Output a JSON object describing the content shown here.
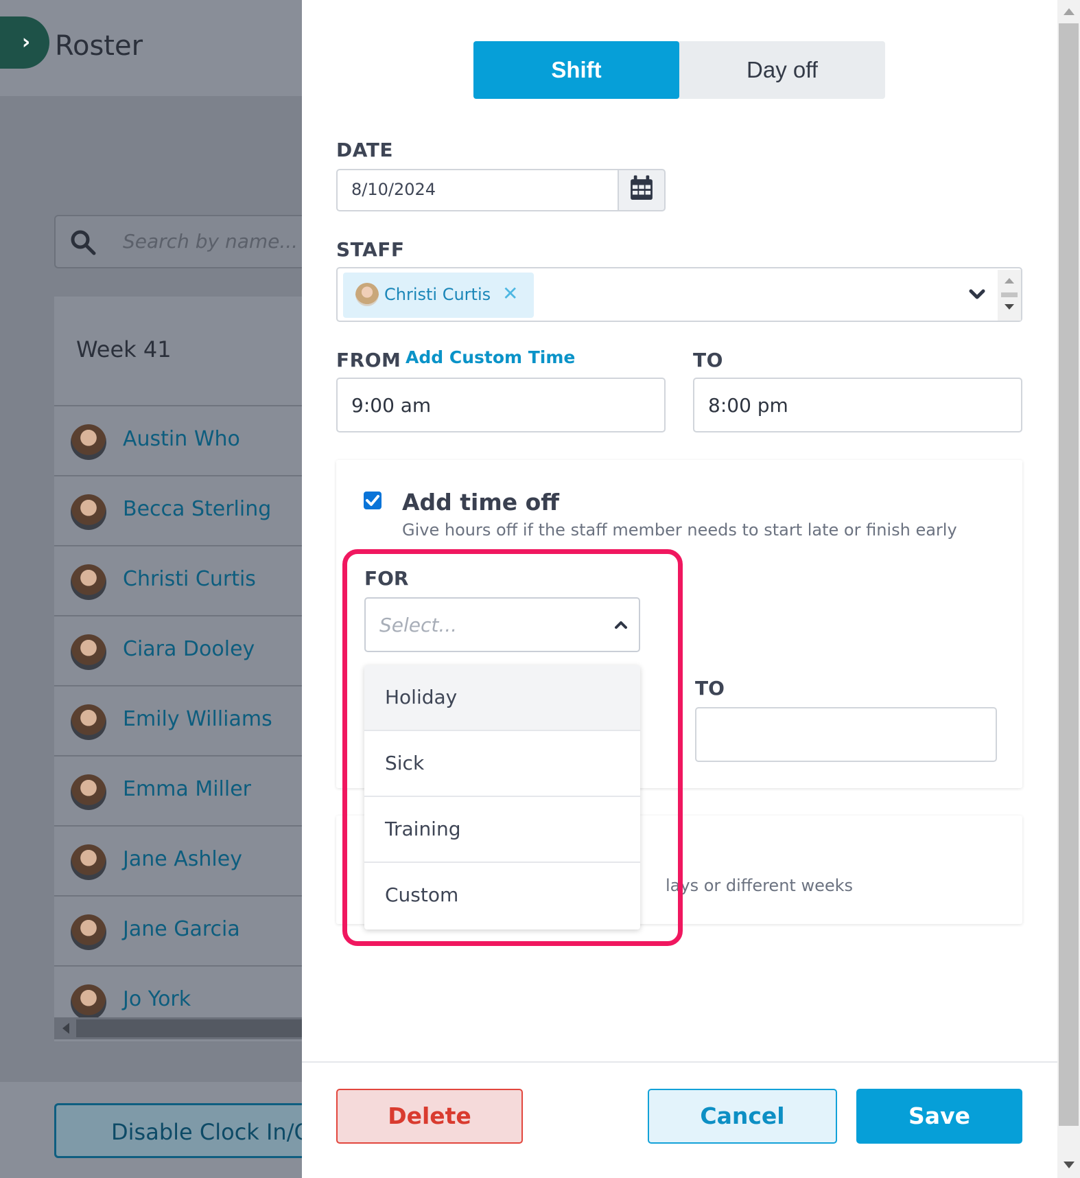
{
  "background": {
    "title": "Roster",
    "search_placeholder": "Search by name...",
    "week_label": "Week 41",
    "staff": [
      "Austin Who",
      "Becca Sterling",
      "Christi Curtis",
      "Ciara Dooley",
      "Emily Williams",
      "Emma Miller",
      "Jane Ashley",
      "Jane Garcia",
      "Jo York"
    ],
    "disable_button": "Disable Clock In/Out"
  },
  "modal": {
    "tabs": {
      "shift": "Shift",
      "day_off": "Day off",
      "active": "Shift"
    },
    "date": {
      "label": "DATE",
      "value": "8/10/2024"
    },
    "staff": {
      "label": "STAFF",
      "selected": "Christi Curtis"
    },
    "from": {
      "label": "FROM",
      "link": "Add Custom Time",
      "value": "9:00 am"
    },
    "to": {
      "label": "TO",
      "value": "8:00 pm"
    },
    "time_off": {
      "checked": true,
      "title": "Add time off",
      "subtitle": "Give hours off if the staff member needs to start late or finish early",
      "for_label": "FOR",
      "for_placeholder": "Select...",
      "options": [
        "Holiday",
        "Sick",
        "Training",
        "Custom"
      ],
      "to_label": "TO"
    },
    "repeat_partial_text": "lays or different weeks",
    "buttons": {
      "delete": "Delete",
      "cancel": "Cancel",
      "save": "Save"
    }
  },
  "colors": {
    "primary": "#069fd8",
    "danger": "#d93b2f",
    "highlight": "#f0175f",
    "link": "#0d5d7e"
  }
}
